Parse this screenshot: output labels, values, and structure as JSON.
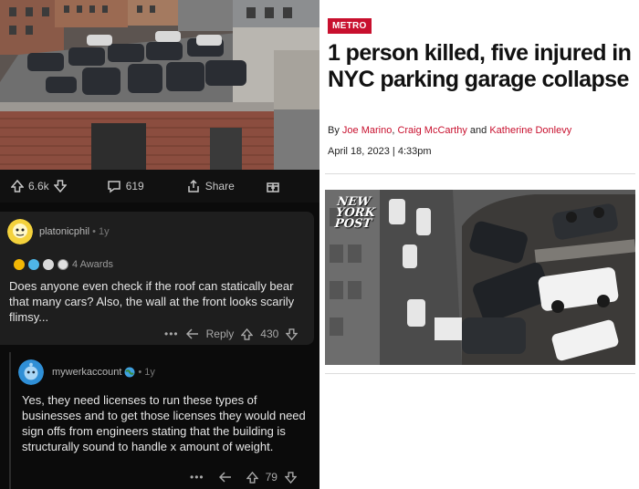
{
  "post": {
    "upvotes": "6.6k",
    "comments_count": "619",
    "share_label": "Share"
  },
  "comments": [
    {
      "username": "platonicphil",
      "age": "1y",
      "awards_label": "4 Awards",
      "text": "Does anyone even check if the roof can statically bear that many cars? Also, the wall at the front looks scarily flimsy...",
      "reply_label": "Reply",
      "score": "430"
    },
    {
      "username": "mywerkaccount",
      "age": "1y",
      "text": "Yes, they need licenses to run these types of businesses and to get those licenses they would need sign offs from engineers stating that the building is structurally sound to handle x amount of weight.",
      "score": "79"
    }
  ],
  "article": {
    "section_tag": "METRO",
    "headline": "1 person killed, five injured in NYC parking garage collapse",
    "by_prefix": "By",
    "authors": [
      "Joe Marino",
      "Craig McCarthy",
      "Katherine Donlevy"
    ],
    "sep_comma": ",",
    "sep_and": "and",
    "date": "April 18, 2023 | 4:33pm",
    "photo_logo": [
      "NEW",
      "YORK",
      "POST"
    ]
  },
  "colors": {
    "brand_red": "#c8102e",
    "reddit_bg": "#0b0b0b",
    "comment_bg": "#1e1e1e"
  }
}
